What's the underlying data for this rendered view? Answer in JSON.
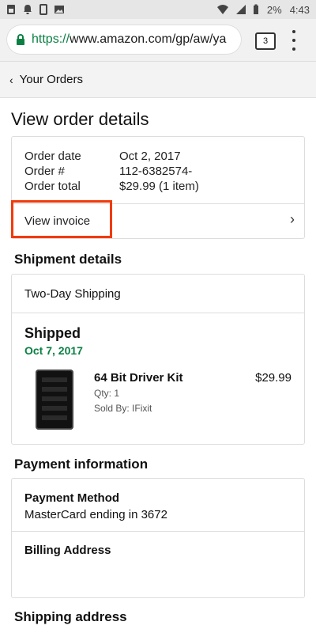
{
  "status_bar": {
    "battery": "2%",
    "time": "4:43"
  },
  "browser": {
    "url_scheme": "https://",
    "url_rest": "www.amazon.com/gp/aw/ya",
    "tab_count": "3"
  },
  "nav": {
    "back_label": "Your Orders"
  },
  "page": {
    "title": "View order details"
  },
  "order": {
    "date_label": "Order date",
    "date_value": "Oct 2, 2017",
    "number_label": "Order #",
    "number_value": "112-6382574-",
    "total_label": "Order total",
    "total_value": "$29.99 (1 item)",
    "invoice_label": "View invoice"
  },
  "shipment": {
    "title": "Shipment details",
    "method": "Two-Day Shipping",
    "status": "Shipped",
    "date": "Oct 7, 2017",
    "item": {
      "name": "64 Bit Driver Kit",
      "price": "$29.99",
      "qty": "Qty: 1",
      "seller": "Sold By: IFixit"
    }
  },
  "payment": {
    "title": "Payment information",
    "method_label": "Payment Method",
    "method_value": "MasterCard ending in 3672",
    "billing_label": "Billing Address"
  },
  "shipping_address": {
    "title": "Shipping address"
  },
  "colors": {
    "green": "#0b8043",
    "highlight": "#f13b0b"
  }
}
